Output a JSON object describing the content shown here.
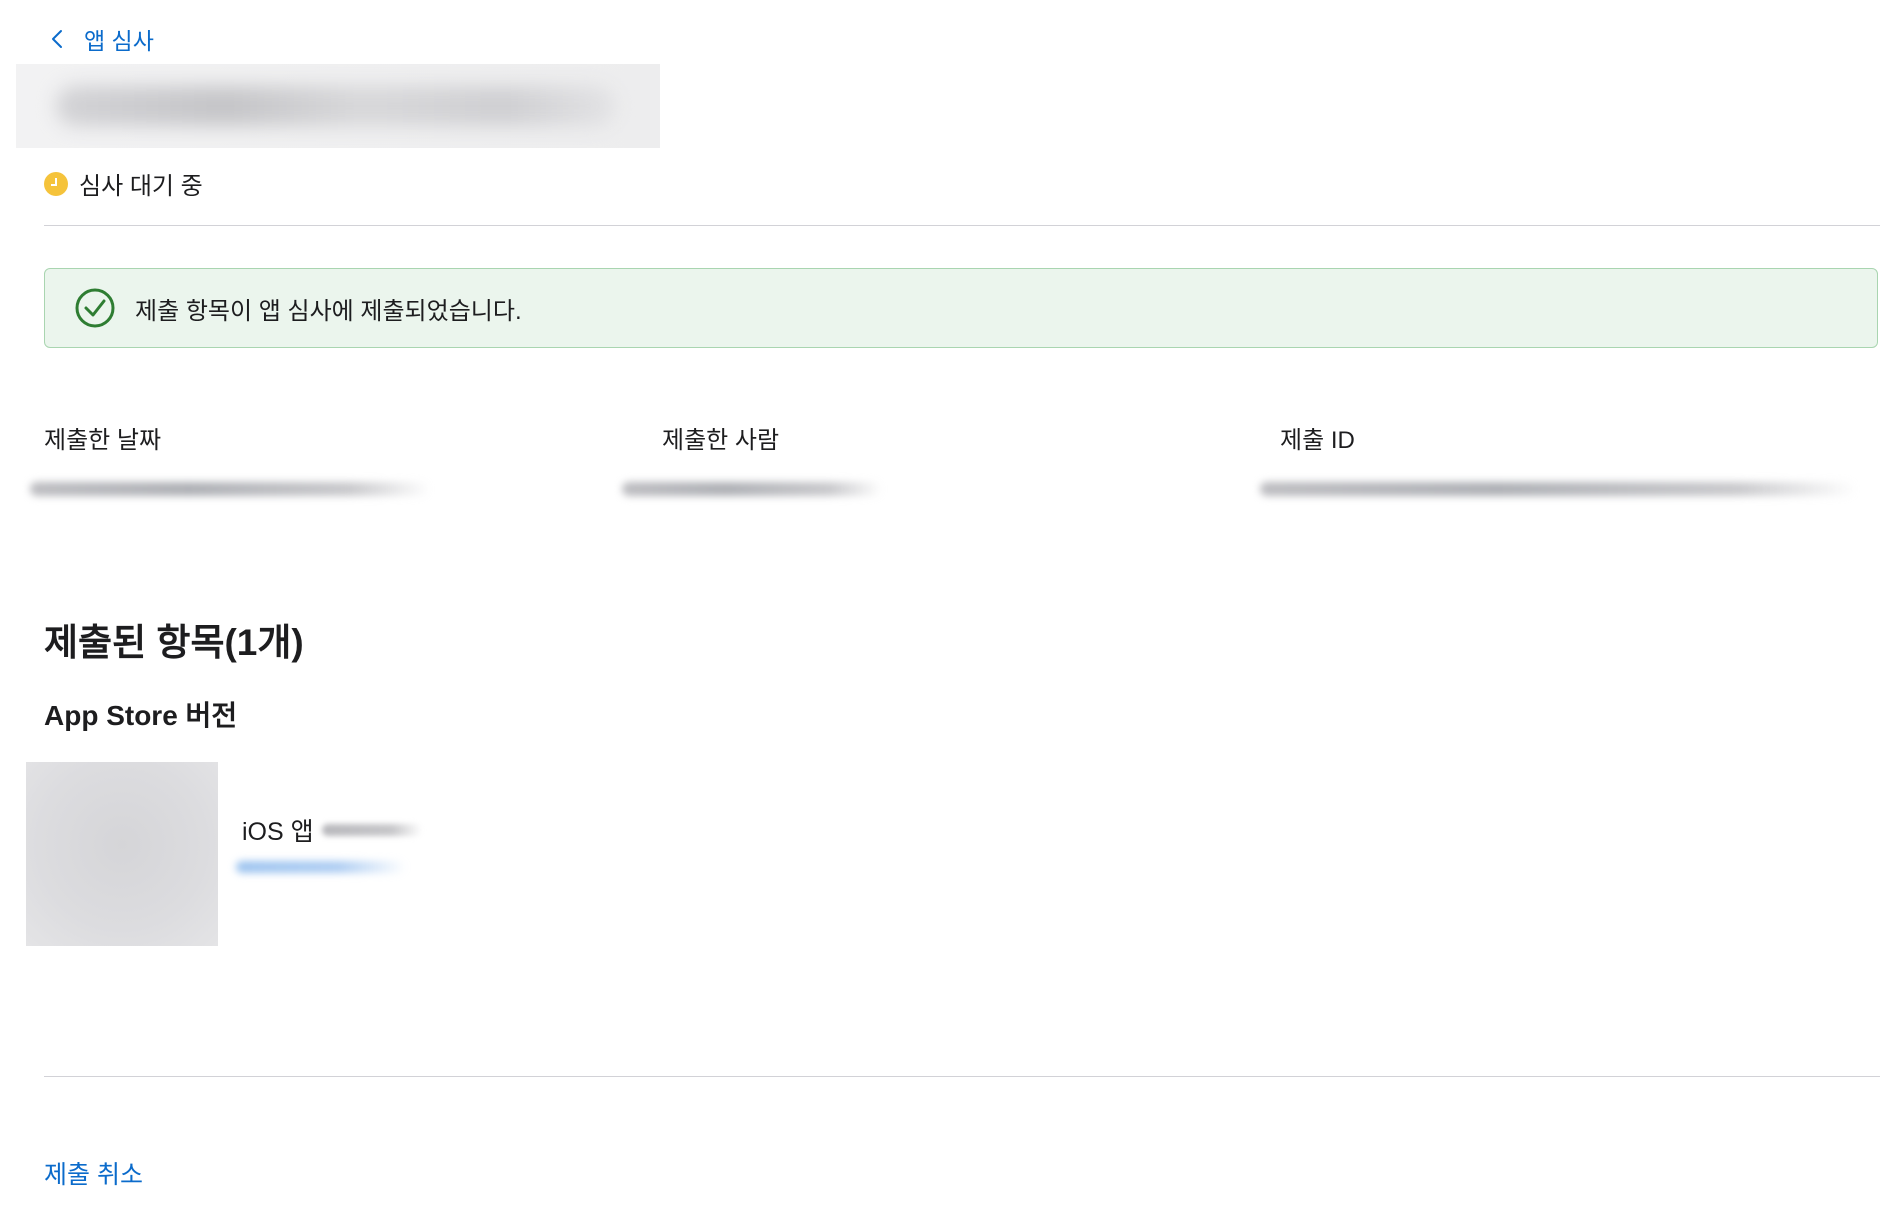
{
  "nav": {
    "back_label": "앱 심사"
  },
  "status": {
    "label": "심사 대기 중",
    "color": "#f5c33b"
  },
  "banner": {
    "message": "제출 항목이 앱 심사에 제출되었습니다.",
    "icon": "check-circle-icon",
    "accent": "#2e7d32"
  },
  "meta": {
    "submitted_date_label": "제출한 날짜",
    "submitted_by_label": "제출한 사람",
    "submission_id_label": "제출 ID"
  },
  "section": {
    "title": "제출된 항목(1개)",
    "subtitle": "App Store 버전"
  },
  "item": {
    "name": "iOS 앱"
  },
  "actions": {
    "cancel_label": "제출 취소"
  },
  "colors": {
    "link": "#0b6bcb",
    "banner_bg": "#ebf5ed",
    "banner_border": "#a9d5b0"
  }
}
